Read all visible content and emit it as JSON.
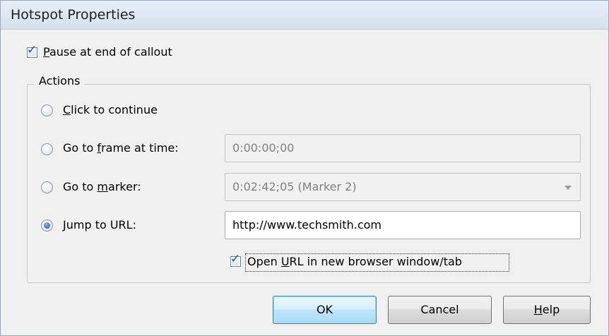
{
  "window": {
    "title": "Hotspot Properties"
  },
  "pause": {
    "label": "Pause at end of callout",
    "mnemonic": "P",
    "checked": true
  },
  "actions": {
    "group_title": "Actions",
    "click_to_continue": {
      "mnemonic": "C",
      "rest": "lick to continue",
      "selected": false
    },
    "go_to_frame": {
      "prefix": "Go to ",
      "mnemonic": "f",
      "rest": "rame at time:",
      "value": "0:00:00;00",
      "selected": false
    },
    "go_to_marker": {
      "prefix": "Go to ",
      "mnemonic": "m",
      "rest": "arker:",
      "value": "0:02:42;05 (Marker 2)",
      "selected": false
    },
    "jump_to_url": {
      "mnemonic": "J",
      "rest": "ump to URL:",
      "value": "http://www.techsmith.com",
      "selected": true
    },
    "open_new_window": {
      "prefix": "Open ",
      "mnemonic": "U",
      "rest": "RL in new browser window/tab",
      "checked": true
    }
  },
  "buttons": {
    "ok": "OK",
    "cancel": "Cancel",
    "help": {
      "mnemonic": "H",
      "rest": "elp"
    }
  },
  "colors": {
    "selected_radio": "#1c4fa3",
    "default_button_border": "#3c7fb1",
    "check": "#2b4a9a"
  }
}
